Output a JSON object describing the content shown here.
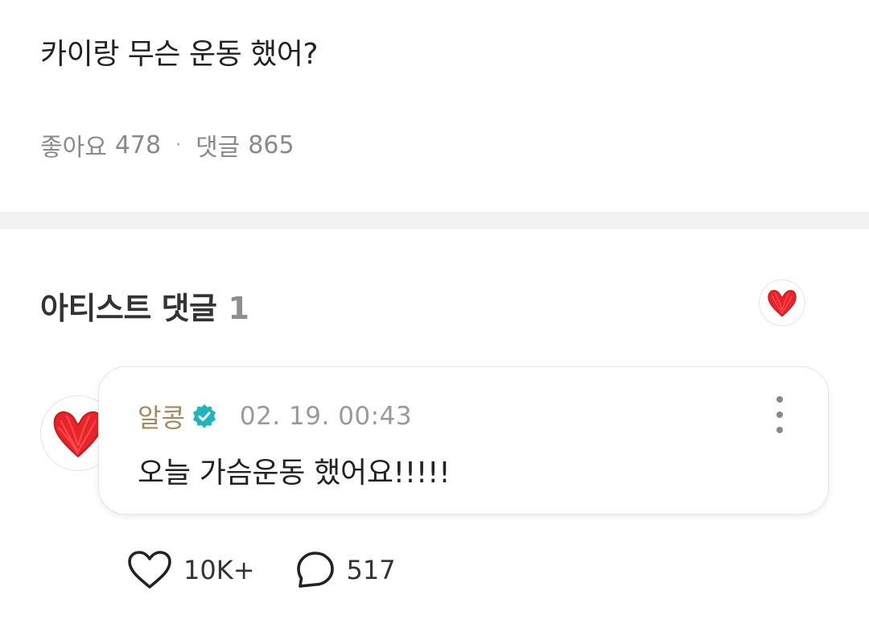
{
  "post": {
    "title": "카이랑 무슨 운동 했어?",
    "likes_label": "좋아요",
    "likes_count": "478",
    "separator": "·",
    "comments_label": "댓글",
    "comments_count": "865"
  },
  "artist_comments": {
    "title": "아티스트 댓글",
    "count": "1",
    "avatar_icon": "red-heart-icon"
  },
  "comment": {
    "author": "알콩",
    "verified_icon": "verified-badge-icon",
    "timestamp": "02. 19. 00:43",
    "text": "오늘 가슴운동 했어요!!!!!",
    "more_icon": "more-vertical-icon",
    "like_count": "10K+",
    "reply_count": "517"
  },
  "colors": {
    "author": "#a5895a",
    "verified": "#1fb5bf",
    "heart": "#e8242b",
    "muted": "#8a8a8a"
  }
}
